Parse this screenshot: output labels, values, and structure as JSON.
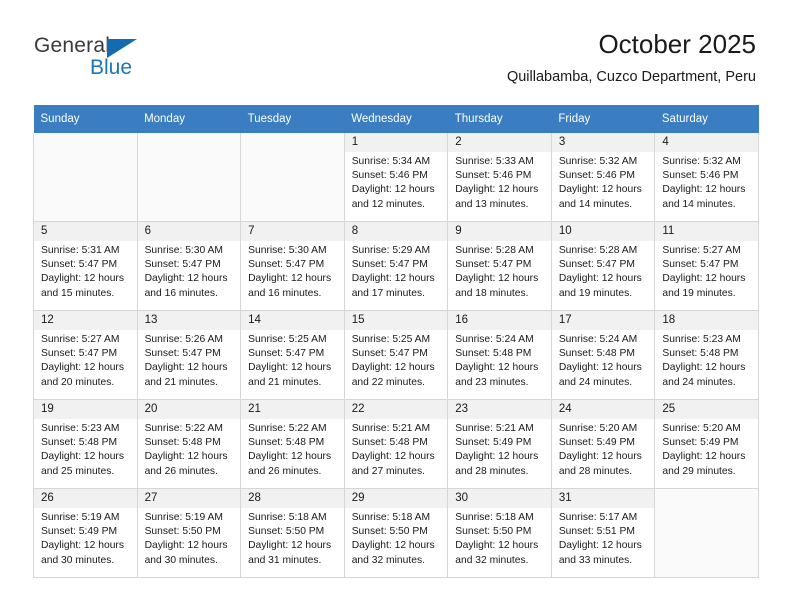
{
  "brand": {
    "name_top": "General",
    "name_bottom": "Blue",
    "triangle_color": "#156bb1",
    "blue_color": "#1b75bb"
  },
  "header": {
    "title": "October 2025",
    "subtitle": "Quillabamba, Cuzco Department, Peru"
  },
  "theme": {
    "header_row_bg": "#3a7dc0",
    "daynum_bg": "#f1f1f1",
    "grid_border": "#d6d6d6",
    "empty_cell_bg": "#fafafa"
  },
  "weekdays": [
    "Sunday",
    "Monday",
    "Tuesday",
    "Wednesday",
    "Thursday",
    "Friday",
    "Saturday"
  ],
  "weeks": [
    [
      {
        "day": "",
        "empty": true
      },
      {
        "day": "",
        "empty": true
      },
      {
        "day": "",
        "empty": true
      },
      {
        "day": "1",
        "sunrise": "Sunrise: 5:34 AM",
        "sunset": "Sunset: 5:46 PM",
        "daylight": "Daylight: 12 hours and 12 minutes."
      },
      {
        "day": "2",
        "sunrise": "Sunrise: 5:33 AM",
        "sunset": "Sunset: 5:46 PM",
        "daylight": "Daylight: 12 hours and 13 minutes."
      },
      {
        "day": "3",
        "sunrise": "Sunrise: 5:32 AM",
        "sunset": "Sunset: 5:46 PM",
        "daylight": "Daylight: 12 hours and 14 minutes."
      },
      {
        "day": "4",
        "sunrise": "Sunrise: 5:32 AM",
        "sunset": "Sunset: 5:46 PM",
        "daylight": "Daylight: 12 hours and 14 minutes."
      }
    ],
    [
      {
        "day": "5",
        "sunrise": "Sunrise: 5:31 AM",
        "sunset": "Sunset: 5:47 PM",
        "daylight": "Daylight: 12 hours and 15 minutes."
      },
      {
        "day": "6",
        "sunrise": "Sunrise: 5:30 AM",
        "sunset": "Sunset: 5:47 PM",
        "daylight": "Daylight: 12 hours and 16 minutes."
      },
      {
        "day": "7",
        "sunrise": "Sunrise: 5:30 AM",
        "sunset": "Sunset: 5:47 PM",
        "daylight": "Daylight: 12 hours and 16 minutes."
      },
      {
        "day": "8",
        "sunrise": "Sunrise: 5:29 AM",
        "sunset": "Sunset: 5:47 PM",
        "daylight": "Daylight: 12 hours and 17 minutes."
      },
      {
        "day": "9",
        "sunrise": "Sunrise: 5:28 AM",
        "sunset": "Sunset: 5:47 PM",
        "daylight": "Daylight: 12 hours and 18 minutes."
      },
      {
        "day": "10",
        "sunrise": "Sunrise: 5:28 AM",
        "sunset": "Sunset: 5:47 PM",
        "daylight": "Daylight: 12 hours and 19 minutes."
      },
      {
        "day": "11",
        "sunrise": "Sunrise: 5:27 AM",
        "sunset": "Sunset: 5:47 PM",
        "daylight": "Daylight: 12 hours and 19 minutes."
      }
    ],
    [
      {
        "day": "12",
        "sunrise": "Sunrise: 5:27 AM",
        "sunset": "Sunset: 5:47 PM",
        "daylight": "Daylight: 12 hours and 20 minutes."
      },
      {
        "day": "13",
        "sunrise": "Sunrise: 5:26 AM",
        "sunset": "Sunset: 5:47 PM",
        "daylight": "Daylight: 12 hours and 21 minutes."
      },
      {
        "day": "14",
        "sunrise": "Sunrise: 5:25 AM",
        "sunset": "Sunset: 5:47 PM",
        "daylight": "Daylight: 12 hours and 21 minutes."
      },
      {
        "day": "15",
        "sunrise": "Sunrise: 5:25 AM",
        "sunset": "Sunset: 5:47 PM",
        "daylight": "Daylight: 12 hours and 22 minutes."
      },
      {
        "day": "16",
        "sunrise": "Sunrise: 5:24 AM",
        "sunset": "Sunset: 5:48 PM",
        "daylight": "Daylight: 12 hours and 23 minutes."
      },
      {
        "day": "17",
        "sunrise": "Sunrise: 5:24 AM",
        "sunset": "Sunset: 5:48 PM",
        "daylight": "Daylight: 12 hours and 24 minutes."
      },
      {
        "day": "18",
        "sunrise": "Sunrise: 5:23 AM",
        "sunset": "Sunset: 5:48 PM",
        "daylight": "Daylight: 12 hours and 24 minutes."
      }
    ],
    [
      {
        "day": "19",
        "sunrise": "Sunrise: 5:23 AM",
        "sunset": "Sunset: 5:48 PM",
        "daylight": "Daylight: 12 hours and 25 minutes."
      },
      {
        "day": "20",
        "sunrise": "Sunrise: 5:22 AM",
        "sunset": "Sunset: 5:48 PM",
        "daylight": "Daylight: 12 hours and 26 minutes."
      },
      {
        "day": "21",
        "sunrise": "Sunrise: 5:22 AM",
        "sunset": "Sunset: 5:48 PM",
        "daylight": "Daylight: 12 hours and 26 minutes."
      },
      {
        "day": "22",
        "sunrise": "Sunrise: 5:21 AM",
        "sunset": "Sunset: 5:48 PM",
        "daylight": "Daylight: 12 hours and 27 minutes."
      },
      {
        "day": "23",
        "sunrise": "Sunrise: 5:21 AM",
        "sunset": "Sunset: 5:49 PM",
        "daylight": "Daylight: 12 hours and 28 minutes."
      },
      {
        "day": "24",
        "sunrise": "Sunrise: 5:20 AM",
        "sunset": "Sunset: 5:49 PM",
        "daylight": "Daylight: 12 hours and 28 minutes."
      },
      {
        "day": "25",
        "sunrise": "Sunrise: 5:20 AM",
        "sunset": "Sunset: 5:49 PM",
        "daylight": "Daylight: 12 hours and 29 minutes."
      }
    ],
    [
      {
        "day": "26",
        "sunrise": "Sunrise: 5:19 AM",
        "sunset": "Sunset: 5:49 PM",
        "daylight": "Daylight: 12 hours and 30 minutes."
      },
      {
        "day": "27",
        "sunrise": "Sunrise: 5:19 AM",
        "sunset": "Sunset: 5:50 PM",
        "daylight": "Daylight: 12 hours and 30 minutes."
      },
      {
        "day": "28",
        "sunrise": "Sunrise: 5:18 AM",
        "sunset": "Sunset: 5:50 PM",
        "daylight": "Daylight: 12 hours and 31 minutes."
      },
      {
        "day": "29",
        "sunrise": "Sunrise: 5:18 AM",
        "sunset": "Sunset: 5:50 PM",
        "daylight": "Daylight: 12 hours and 32 minutes."
      },
      {
        "day": "30",
        "sunrise": "Sunrise: 5:18 AM",
        "sunset": "Sunset: 5:50 PM",
        "daylight": "Daylight: 12 hours and 32 minutes."
      },
      {
        "day": "31",
        "sunrise": "Sunrise: 5:17 AM",
        "sunset": "Sunset: 5:51 PM",
        "daylight": "Daylight: 12 hours and 33 minutes."
      },
      {
        "day": "",
        "empty": true
      }
    ]
  ]
}
